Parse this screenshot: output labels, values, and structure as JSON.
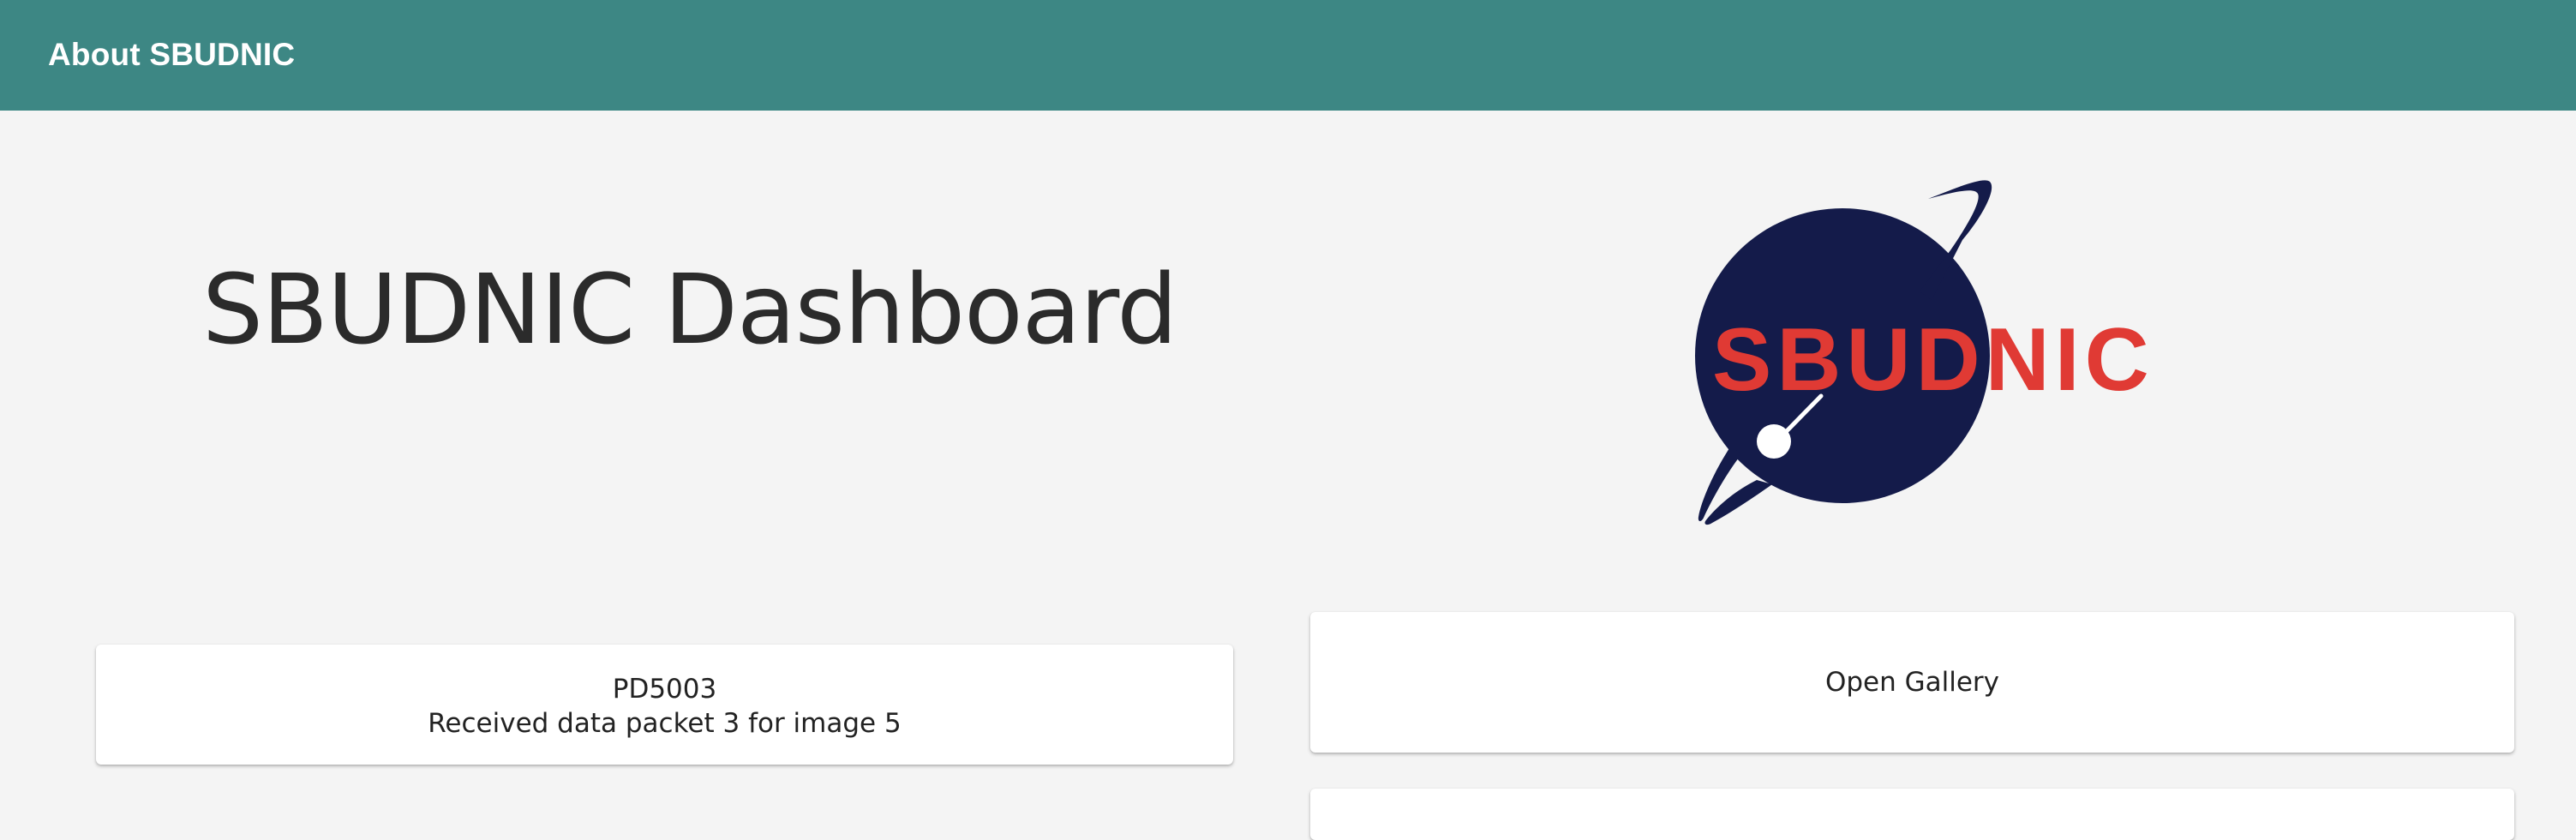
{
  "header": {
    "title": "About SBUDNIC"
  },
  "main": {
    "title": "SBUDNIC Dashboard",
    "logo": {
      "text": "SBUDNIC",
      "colors": {
        "planet": "#141b4a",
        "text": "#e03a34"
      }
    },
    "status_card": {
      "code": "PD5003",
      "message": "Received data packet 3 for image 5"
    },
    "gallery_button": {
      "label": "Open Gallery"
    }
  },
  "colors": {
    "header_bg": "#3d8784",
    "page_bg": "#f4f4f4",
    "card_bg": "#ffffff",
    "title_text": "#2b2b2b"
  }
}
